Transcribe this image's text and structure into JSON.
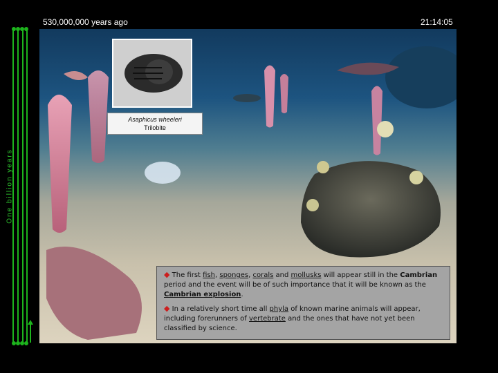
{
  "header": {
    "time_ago": "530,000,000 years ago",
    "clock": "21:14:05"
  },
  "timeline": {
    "label": "One billion years"
  },
  "fossil": {
    "species": "Asaphicus wheeleri",
    "group": "Trilobite"
  },
  "info": {
    "bullet_symbol": "◆",
    "p1": {
      "t1": "The first ",
      "fish": "fish",
      "c1": ", ",
      "sponges": "sponges",
      "c2": ", ",
      "corals": "corals",
      "t2": " and ",
      "mollusks": "mollusks",
      "t3": " will appear still in the ",
      "cambrian": "Cambrian",
      "t4": " period and the event will be of such importance that it will be known as the ",
      "explosion": "Cambrian explosion",
      "t5": "."
    },
    "p2": {
      "t1": "In a relatively short time all ",
      "phyla": "phyla",
      "t2": " of known marine animals will appear, including forerunners of ",
      "vertebrate": "vertebrate",
      "t3": " and the ones that have not yet been classified by science."
    }
  },
  "colors": {
    "timeline_green": "#1db41d",
    "bullet_red": "#cc1e1e",
    "infobox_gray": "#a4a4a4"
  }
}
